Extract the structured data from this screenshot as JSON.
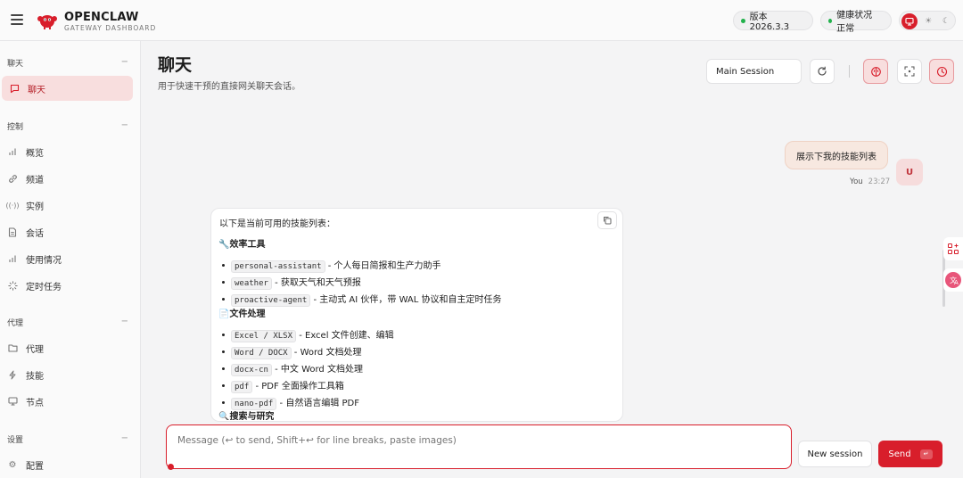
{
  "app": {
    "brand_title": "OPENCLAW",
    "brand_subtitle": "GATEWAY DASHBOARD"
  },
  "status": {
    "version_label": "版本 2026.3.3",
    "health_label": "健康状况 正常",
    "ok_color": "#22b14c"
  },
  "theme": {
    "active": "monitor",
    "options": [
      "monitor-icon",
      "sun-icon",
      "moon-icon"
    ]
  },
  "colors": {
    "accent": "#d81e2b",
    "accent_soft": "#f8dede"
  },
  "sidebar": {
    "sections": [
      {
        "label": "聊天",
        "items": [
          {
            "label": "聊天",
            "icon": "chat-bubble-icon",
            "active": true
          }
        ]
      },
      {
        "label": "控制",
        "items": [
          {
            "label": "概览",
            "icon": "bar-chart-icon"
          },
          {
            "label": "频道",
            "icon": "link-icon"
          },
          {
            "label": "实例",
            "icon": "radio-waves-icon"
          },
          {
            "label": "会话",
            "icon": "document-icon"
          },
          {
            "label": "使用情况",
            "icon": "bar-chart-icon"
          },
          {
            "label": "定时任务",
            "icon": "loader-icon"
          }
        ]
      },
      {
        "label": "代理",
        "items": [
          {
            "label": "代理",
            "icon": "folder-icon"
          },
          {
            "label": "技能",
            "icon": "bolt-icon"
          },
          {
            "label": "节点",
            "icon": "monitor-icon"
          }
        ]
      },
      {
        "label": "设置",
        "items": [
          {
            "label": "配置",
            "icon": "gear-icon"
          }
        ]
      }
    ],
    "collapse_symbol": "−"
  },
  "page": {
    "title": "聊天",
    "subtitle": "用于快速干预的直接网关聊天会话。",
    "session_selected": "Main Session"
  },
  "chat": {
    "user_message": "展示下我的技能列表",
    "user_avatar": "U",
    "user_name": "You",
    "user_time": "23:27",
    "assistant": {
      "intro": "以下是当前可用的技能列表：",
      "sections": [
        {
          "icon": "🔧",
          "heading": "效率工具",
          "items": [
            {
              "code": "personal-assistant",
              "desc": " - 个人每日简报和生产力助手"
            },
            {
              "code": "weather",
              "desc": " - 获取天气和天气预报"
            },
            {
              "code": "proactive-agent",
              "desc": " - 主动式 AI 伙伴，带 WAL 协议和自主定时任务"
            }
          ]
        },
        {
          "icon": "📄",
          "heading": "文件处理",
          "items": [
            {
              "code": "Excel / XLSX",
              "desc": " - Excel 文件创建、编辑"
            },
            {
              "code": "Word / DOCX",
              "desc": " - Word 文档处理"
            },
            {
              "code": "docx-cn",
              "desc": " - 中文 Word 文档处理"
            },
            {
              "code": "pdf",
              "desc": " - PDF 全面操作工具箱"
            },
            {
              "code": "nano-pdf",
              "desc": " - 自然语言编辑 PDF"
            }
          ]
        },
        {
          "icon": "🔍",
          "heading": "搜索与研究",
          "items": []
        }
      ]
    }
  },
  "composer": {
    "placeholder": "Message (↩ to send, Shift+↩ for line breaks, paste images)",
    "new_session_label": "New session",
    "send_label": "Send",
    "send_key": "↵"
  }
}
